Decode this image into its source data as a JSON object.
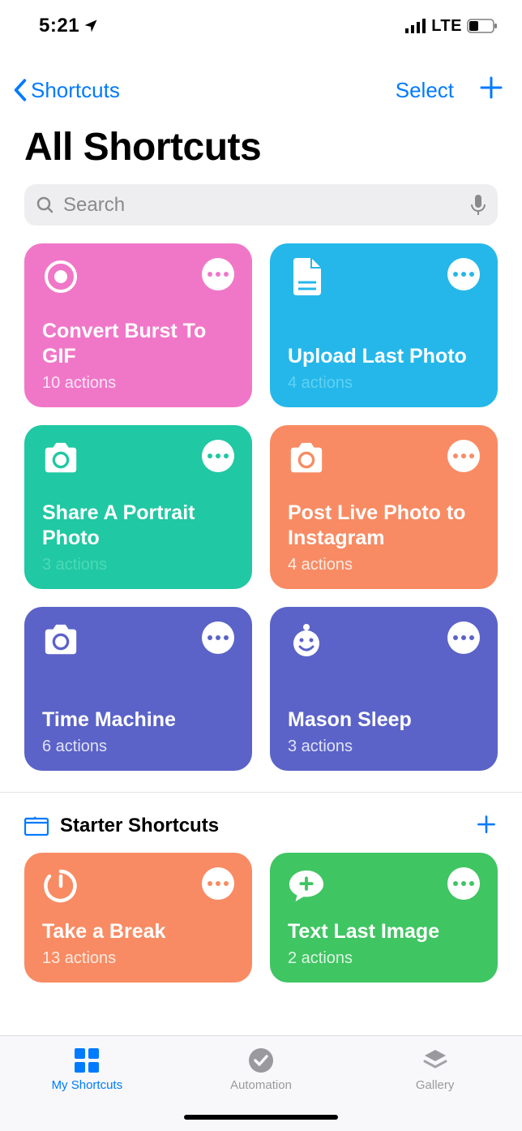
{
  "status": {
    "time": "5:21",
    "network": "LTE"
  },
  "nav": {
    "back": "Shortcuts",
    "select": "Select"
  },
  "title": "All Shortcuts",
  "search": {
    "placeholder": "Search"
  },
  "shortcuts": [
    {
      "title": "Convert Burst To GIF",
      "sub": "10 actions",
      "bg": "#f077c8",
      "dot": "#f077c8",
      "icon": "target"
    },
    {
      "title": "Upload Last Photo",
      "sub": "4 actions",
      "bg": "#25b7ea",
      "dot": "#25b7ea",
      "icon": "doc",
      "subcolor": "#5fd1f2"
    },
    {
      "title": "Share A Portrait Photo",
      "sub": "3 actions",
      "bg": "#20c8a3",
      "dot": "#20c8a3",
      "icon": "camera",
      "subcolor": "#4cd9b7"
    },
    {
      "title": "Post Live Photo to Instagram",
      "sub": "4 actions",
      "bg": "#f88b63",
      "dot": "#f88b63",
      "icon": "camera"
    },
    {
      "title": "Time Machine",
      "sub": "6 actions",
      "bg": "#5b63c8",
      "dot": "#5b63c8",
      "icon": "camera"
    },
    {
      "title": "Mason Sleep",
      "sub": "3 actions",
      "bg": "#5b63c8",
      "dot": "#5b63c8",
      "icon": "baby"
    }
  ],
  "section": {
    "title": "Starter Shortcuts"
  },
  "starters": [
    {
      "title": "Take a Break",
      "sub": "13 actions",
      "bg": "#f88b63",
      "dot": "#f88b63",
      "icon": "timer"
    },
    {
      "title": "Text Last Image",
      "sub": "2 actions",
      "bg": "#3fc562",
      "dot": "#3fc562",
      "icon": "bubbleplus"
    }
  ],
  "tabs": {
    "my": "My Shortcuts",
    "automation": "Automation",
    "gallery": "Gallery"
  }
}
